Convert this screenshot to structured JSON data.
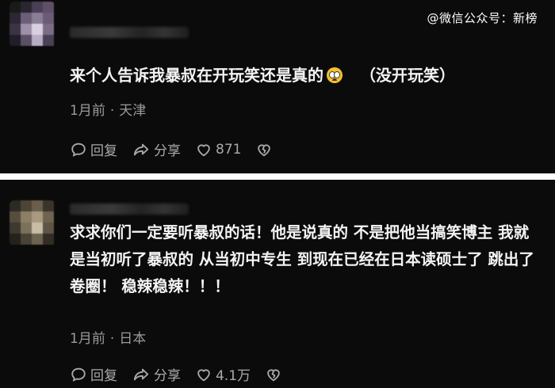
{
  "watermark": "@微信公众号：新榜",
  "comments": [
    {
      "text_main": "来个人告诉我暴叔在开玩笑还是真的",
      "text_paren": "（没开玩笑）",
      "emoji": "pleading-face-emoji",
      "time": "1月前",
      "separator": "·",
      "location": "天津",
      "reply_label": "回复",
      "share_label": "分享",
      "like_count": "871"
    },
    {
      "text": "求求你们一定要听暴叔的话！他是说真的 不是把他当搞笑博主 我就是当初听了暴叔的 从当初中专生 到现在已经在日本读硕士了 跳出了卷圈！ 稳辣稳辣！！！",
      "time": "1月前",
      "separator": "·",
      "location": "日本",
      "reply_label": "回复",
      "share_label": "分享",
      "like_count": "4.1万"
    }
  ],
  "colors": {
    "background": "#0b0b0b",
    "text": "#f4f4f4",
    "meta": "#9b9b9b",
    "divider": "#ffffff"
  }
}
